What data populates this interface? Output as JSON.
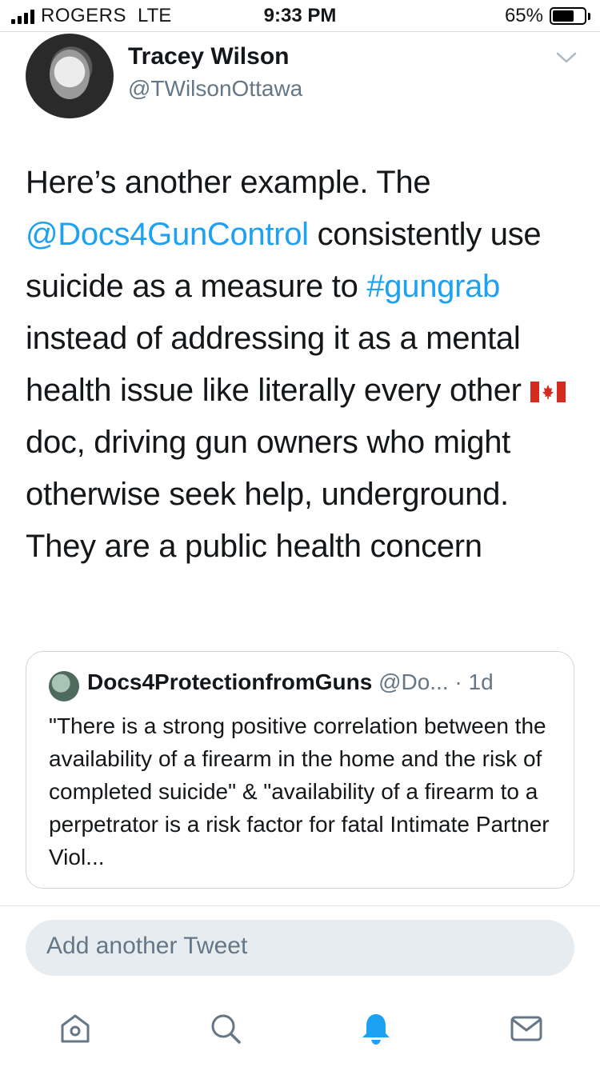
{
  "status_bar": {
    "carrier": "ROGERS",
    "network": "LTE",
    "time": "9:33 PM",
    "battery": "65%"
  },
  "tweet": {
    "author_name": "Tracey Wilson",
    "author_handle": "@TWilsonOttawa",
    "text_1": "Here’s another example. The ",
    "mention": "@Docs4GunControl",
    "text_2": " consistently use suicide as a measure to ",
    "hashtag": "#gungrab",
    "text_3": " instead of addressing it as a mental health issue like literally every other ",
    "flag_icon": "canada-flag-icon",
    "text_4": " doc, driving gun owners who might otherwise seek help, underground. They are a public health concern",
    "menu_icon": "chevron-down-icon"
  },
  "quote": {
    "name": "Docs4ProtectionfromGuns",
    "handle": "@Do...",
    "time": " · 1d",
    "text": "\"There is a strong positive correlation between the availability of a firearm in the home and the risk of completed suicide\" & \"availability of a firearm to a perpetrator is a risk factor for fatal Intimate Partner Viol..."
  },
  "compose": {
    "placeholder": "Add another Tweet"
  },
  "tab_bar": {
    "icons": [
      "home-icon",
      "search-icon",
      "notifications-icon",
      "messages-icon"
    ],
    "active_color": "#1da1f2",
    "inactive_color": "#657786"
  },
  "colors": {
    "link": "#1da1f2",
    "secondary_text": "#657786",
    "primary_text": "#14171a"
  }
}
